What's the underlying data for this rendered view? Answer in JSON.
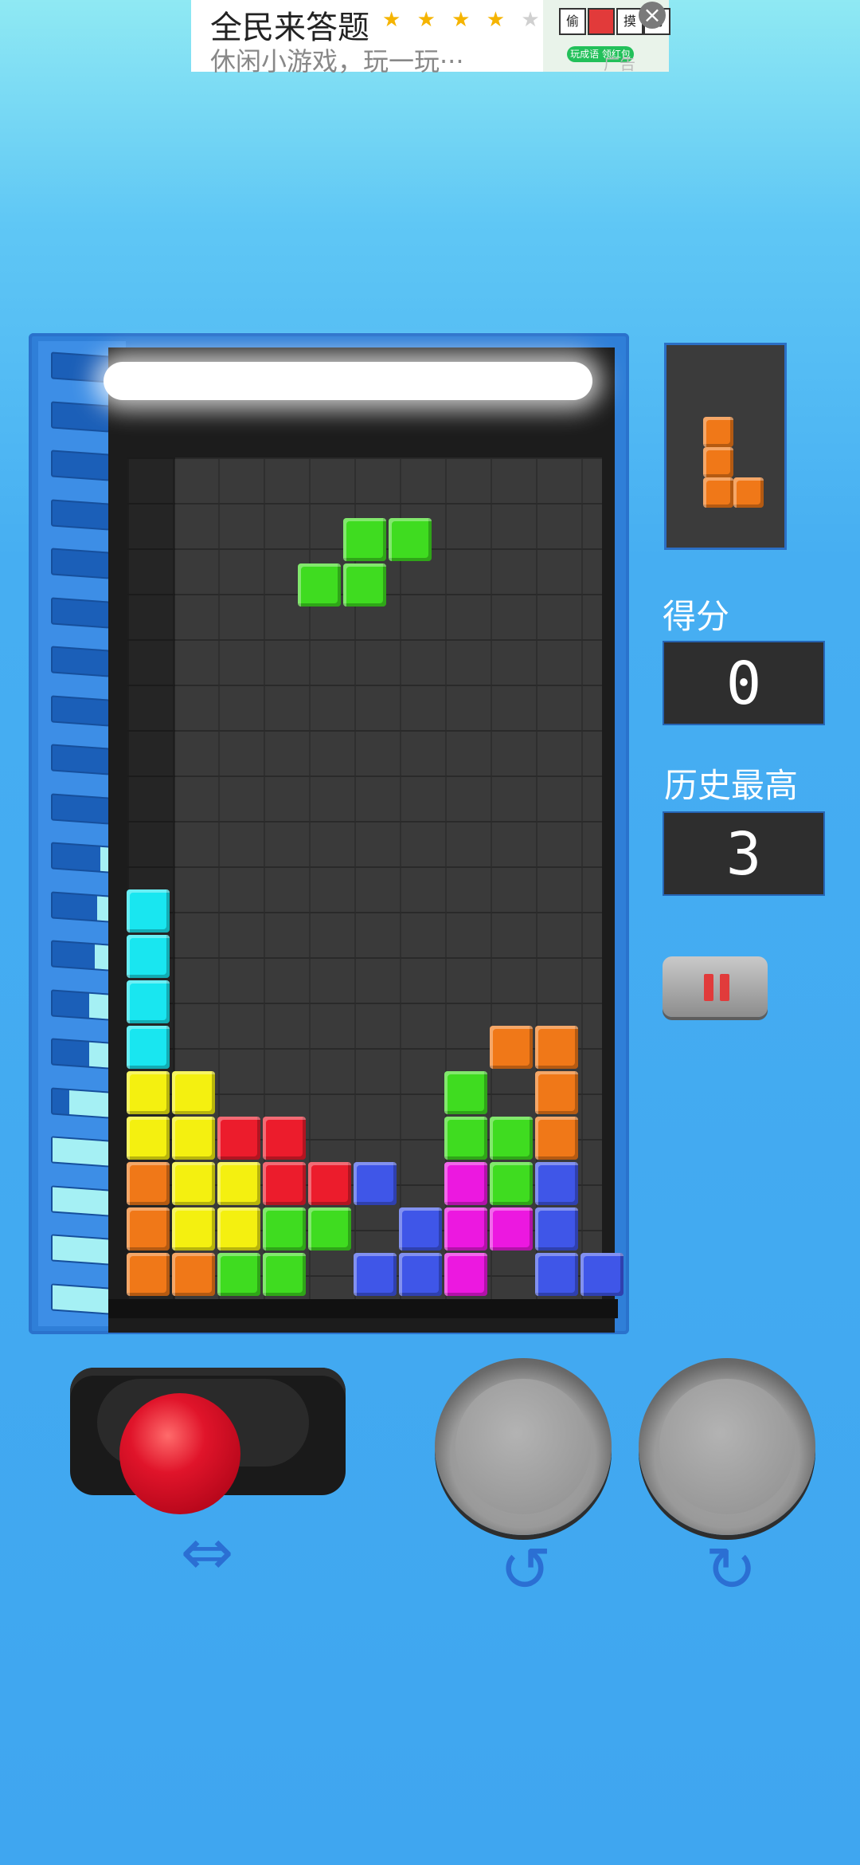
{
  "ad": {
    "title": "全民来答题",
    "stars": [
      "★",
      "★",
      "★",
      "★",
      "★"
    ],
    "stars_on": 4,
    "subtitle": "休闲小游戏，玩一玩···",
    "thumb_cells": [
      "偷",
      "",
      "摸",
      "狗"
    ],
    "thumb_button": "玩成语 领红包",
    "tag": "广告",
    "close": "×"
  },
  "scoreboard": {
    "score_label": "得分",
    "score_value": "0",
    "best_label": "历史最高",
    "best_value": "3"
  },
  "next_piece": {
    "shape": "L",
    "color": "#f07818"
  },
  "colors": {
    "cyan": "#19e6f0",
    "yellow": "#f4f010",
    "red": "#ec1c2c",
    "orange": "#f07818",
    "green": "#3fdc20",
    "blue": "#3f56e8",
    "magenta": "#ec18e0",
    "accent": "#3fa6f0"
  },
  "board": {
    "columns": 10,
    "rows": 18,
    "falling_piece": {
      "shape": "S",
      "color": "green"
    },
    "stack_rows_bottom_up": [
      "OOGG.BBM.BB",
      "OYYGG.BMMB",
      "OYYRRB.MGB",
      "YYRR...GGO",
      "YY.....G.O",
      "C.......OO",
      "C",
      "C",
      "C"
    ]
  },
  "level_meter": {
    "segments": 20,
    "lit_fraction_bottom": [
      1,
      1,
      1,
      1,
      0.7,
      0.35,
      0.35,
      0.25,
      0.2,
      0.15
    ]
  },
  "controls": {
    "joystick_icon": "⇔",
    "rotate_left_icon": "↺",
    "rotate_right_icon": "↻",
    "pause_icon": "pause-icon"
  }
}
